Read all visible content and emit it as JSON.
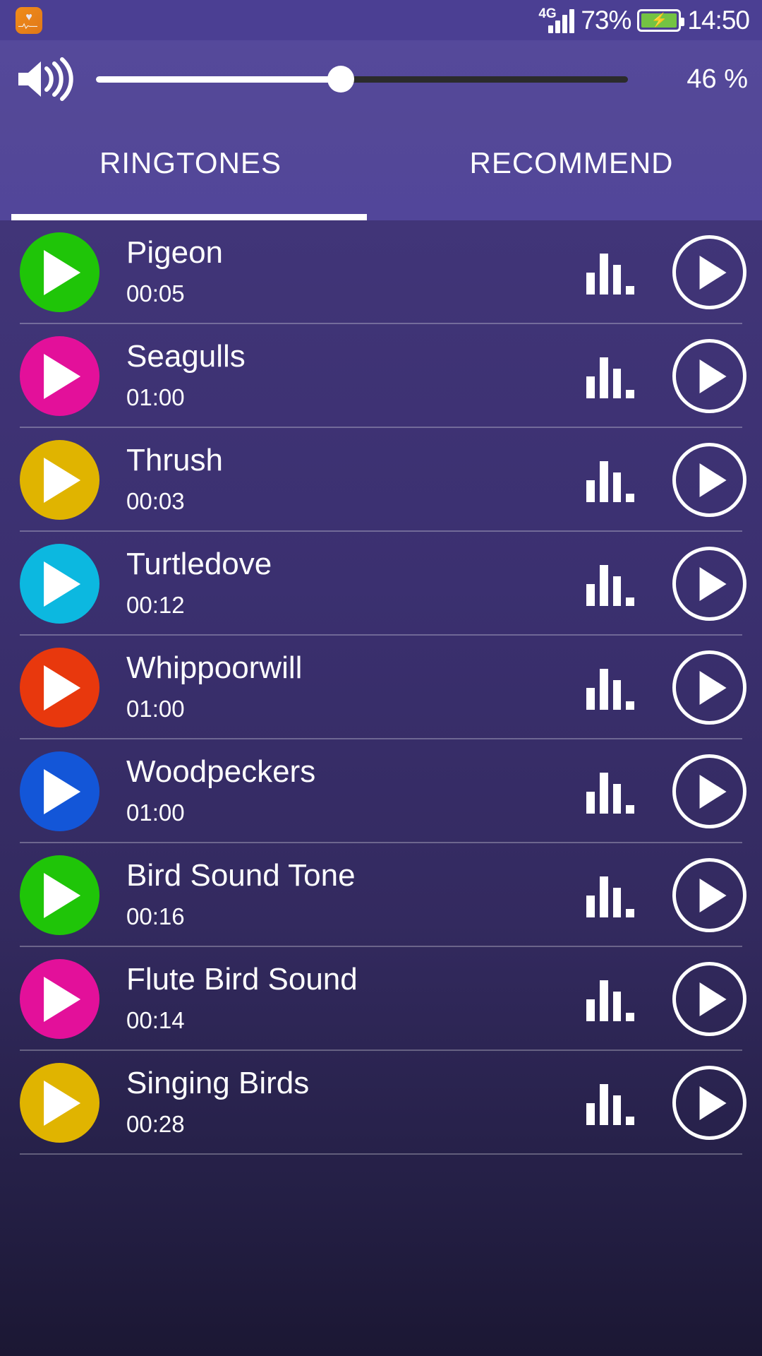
{
  "status_bar": {
    "app_icon": "heart-rate-app-icon",
    "network_type": "4G",
    "battery_percent": "73%",
    "battery_state": "charging",
    "clock": "14:50"
  },
  "volume": {
    "icon": "speaker-volume-icon",
    "percent_label": "46 %",
    "value": 46
  },
  "tabs": [
    {
      "label": "RINGTONES",
      "selected": true
    },
    {
      "label": "RECOMMEND",
      "selected": false
    }
  ],
  "list": {
    "eq_icon": "equalizer-icon",
    "play_icon": "play-circle-icon",
    "disc_icon": "play-triangle-icon",
    "items": [
      {
        "title": "Pigeon",
        "duration": "00:05",
        "color": "#1fc508"
      },
      {
        "title": "Seagulls",
        "duration": "01:00",
        "color": "#e3109a"
      },
      {
        "title": "Thrush",
        "duration": "00:03",
        "color": "#e0b400"
      },
      {
        "title": "Turtledove",
        "duration": "00:12",
        "color": "#0cb8e0"
      },
      {
        "title": "Whippoorwill",
        "duration": "01:00",
        "color": "#e8380d"
      },
      {
        "title": "Woodpeckers",
        "duration": "01:00",
        "color": "#1356d8"
      },
      {
        "title": "Bird Sound Tone",
        "duration": "00:16",
        "color": "#1fc508"
      },
      {
        "title": "Flute Bird Sound",
        "duration": "00:14",
        "color": "#e3109a"
      },
      {
        "title": "Singing Birds",
        "duration": "00:28",
        "color": "#e0b400"
      }
    ]
  },
  "colors": {
    "status_bar_bg": "#4b3f93",
    "header_bg": "#544897",
    "list_top_bg": "#413578",
    "list_bottom_bg": "#1b1733",
    "accent_white": "#ffffff",
    "slider_track": "#2b2b2b"
  }
}
